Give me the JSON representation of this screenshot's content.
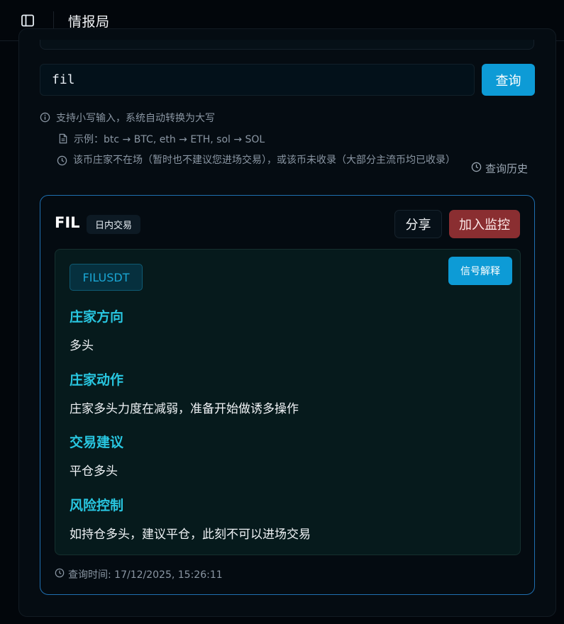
{
  "header": {
    "title": "情报局",
    "toggle_icon": "sidebar-toggle-icon"
  },
  "search": {
    "value": "fil",
    "button_label": "查询"
  },
  "hints": {
    "lowercase": "支持小写输入，系统自动转换为大写",
    "example": "示例：btc → BTC, eth → ETH, sol → SOL",
    "notice": "该币庄家不在场（暂时也不建议您进场交易），或该币未收录（大部分主流币均已收录）",
    "history_label": "查询历史"
  },
  "result": {
    "coin": "FIL",
    "mode": "日内交易",
    "share_label": "分享",
    "monitor_label": "加入监控",
    "symbol": "FILUSDT",
    "explain_label": "信号解释",
    "sections": [
      {
        "title": "庄家方向",
        "body": "多头"
      },
      {
        "title": "庄家动作",
        "body": "庄家多头力度在减弱，准备开始做诱多操作"
      },
      {
        "title": "交易建议",
        "body": "平仓多头"
      },
      {
        "title": "风险控制",
        "body": "如持仓多头，建议平仓，此刻不可以进场交易"
      }
    ],
    "query_time": "查询时间: 17/12/2025, 15:26:11"
  },
  "colors": {
    "accent": "#0d9bd6",
    "section_title": "#28c6e0",
    "monitor": "#8a2e31",
    "card_border": "#1f6fb0"
  }
}
